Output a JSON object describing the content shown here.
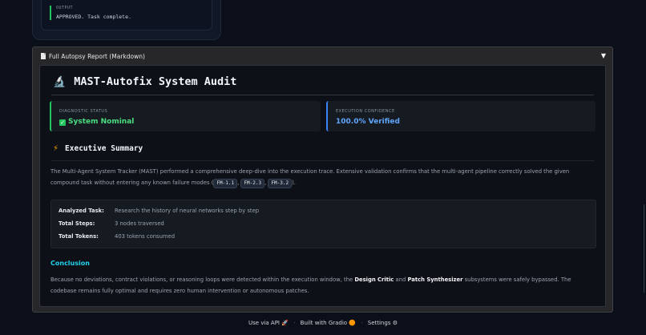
{
  "top_card": {
    "output_label": "OUTPUT",
    "output_text": "APPROVED. Task complete."
  },
  "accordion": {
    "title": "Full Autopsy Report (Markdown)",
    "caret": "▼"
  },
  "report": {
    "title": "MAST-Autofix System Audit",
    "title_icon": "microscope-icon",
    "diagnostic": {
      "label": "DIAGNOSTIC STATUS",
      "value": "System Nominal"
    },
    "confidence": {
      "label": "EXECUTION CONFIDENCE",
      "value": "100.0% Verified"
    },
    "exec_summary": {
      "heading": "Executive Summary",
      "text_before": "The Multi-Agent System Tracker (MAST) performed a comprehensive deep-dive into the execution trace. Extensive validation confirms that the multi-agent pipeline correctly solved the given compound task without entering any known failure modes (",
      "codes": [
        "FM-1.1",
        "FM-2.3",
        "FM-3.2"
      ],
      "sep": ", ",
      "text_after": ")."
    },
    "task": {
      "rows": [
        {
          "key": "Analyzed Task:",
          "value": "Research the history of neural networks step by step"
        },
        {
          "key": "Total Steps:",
          "value": "3 nodes traversed"
        },
        {
          "key": "Total Tokens:",
          "value": "403 tokens consumed"
        }
      ]
    },
    "conclusion": {
      "heading": "Conclusion",
      "t1": "Because no deviations, contract violations, or reasoning loops were detected within the execution window, the ",
      "b1": "Design Critic",
      "t2": " and ",
      "b2": "Patch Synthesizer",
      "t3": " subsystems were safely bypassed. The codebase remains fully optimal and requires zero human intervention or autonomous patches."
    }
  },
  "footer": {
    "api": "Use via API",
    "built": "Built with Gradio",
    "settings": "Settings",
    "dot": "·"
  },
  "colors": {
    "accent_green": "#22c55e",
    "accent_blue": "#3b82f6",
    "accent_cyan": "#22d3ee"
  }
}
